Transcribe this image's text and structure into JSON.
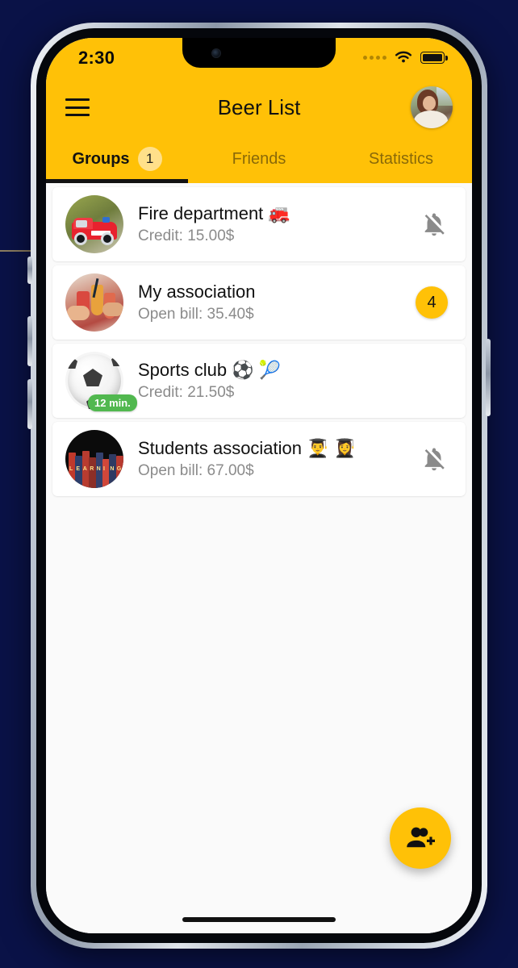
{
  "theme": {
    "accent": "#FFC107",
    "badge_light": "#FFE08A",
    "page_bg": "#0A1247",
    "list_bg": "#FAFAFA",
    "card_bg": "#FFFFFF",
    "muted_text": "#8B8B8B",
    "online_badge": "#51B84F"
  },
  "status_bar": {
    "time": "2:30",
    "wifi_icon": "wifi-icon",
    "battery_icon": "battery-full-icon",
    "signal_icon": "signal-dots-icon"
  },
  "app_bar": {
    "menu_icon": "hamburger-menu-icon",
    "title": "Beer List",
    "profile_avatar": "user-profile-avatar"
  },
  "tabs": {
    "active_index": 0,
    "items": [
      {
        "label": "Groups",
        "badge": "1"
      },
      {
        "label": "Friends",
        "badge": ""
      },
      {
        "label": "Statistics",
        "badge": ""
      }
    ]
  },
  "groups": [
    {
      "title": "Fire department 🚒",
      "subtitle": "Credit: 15.00$",
      "avatar_icon": "fire-truck-avatar",
      "right_icon": "notifications-off-icon",
      "badge": "",
      "time_badge": ""
    },
    {
      "title": "My association",
      "subtitle": "Open bill: 35.40$",
      "avatar_icon": "drinks-toast-avatar",
      "right_icon": "",
      "badge": "4",
      "time_badge": ""
    },
    {
      "title": "Sports club ⚽ 🎾",
      "subtitle": "Credit: 21.50$",
      "avatar_icon": "soccer-ball-avatar",
      "right_icon": "",
      "badge": "",
      "time_badge": "12 min."
    },
    {
      "title": "Students association 👨‍🎓 👩‍🎓",
      "subtitle": "Open bill: 67.00$",
      "avatar_icon": "books-learning-avatar",
      "right_icon": "notifications-off-icon",
      "badge": "",
      "time_badge": ""
    }
  ],
  "fab": {
    "icon": "group-add-icon",
    "label": ""
  },
  "books_letters": [
    "L",
    "E",
    "A",
    "R",
    "N",
    "I",
    "N",
    "G"
  ]
}
